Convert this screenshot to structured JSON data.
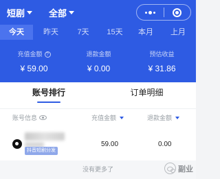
{
  "header": {
    "category_select": "短剧",
    "scope_select": "全部",
    "capsule": {
      "more_icon": "more-dots-icon",
      "close_icon": "target-close-icon"
    }
  },
  "tabs": [
    "今天",
    "昨天",
    "7天",
    "15天",
    "本月",
    "上月"
  ],
  "active_tab": "今天",
  "stats": [
    {
      "label": "充值金额",
      "value": "¥ 59.00",
      "has_help": true
    },
    {
      "label": "退款金额",
      "value": "¥ 0.00",
      "has_help": false
    },
    {
      "label": "预估收益",
      "value": "¥ 31.86",
      "has_help": false
    }
  ],
  "segments": [
    "账号排行",
    "订单明细"
  ],
  "active_segment": "账号排行",
  "table": {
    "headers": {
      "account": "账号信息",
      "recharge": "充值金额",
      "refund": "退款金额"
    },
    "rows": [
      {
        "tag": "抖音短剧分发",
        "recharge": "59.00",
        "refund": "0.00"
      }
    ]
  },
  "footer_text": "没有更多了",
  "watermark": "副业",
  "colors": {
    "primary": "#2e5be3",
    "tab_active_bg": "#4b73ee",
    "tag_bg": "#8fa8ea"
  }
}
